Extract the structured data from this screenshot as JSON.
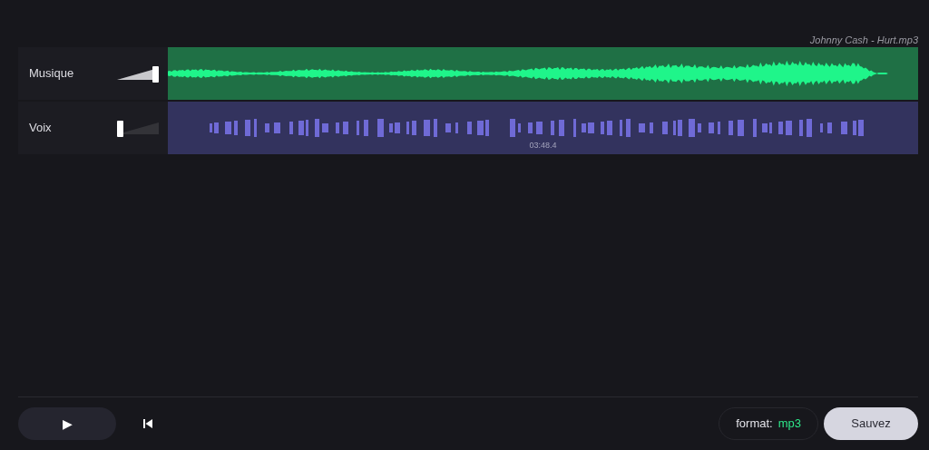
{
  "file_name": "Johnny Cash - Hurt.mp3",
  "tracks": [
    {
      "name": "Musique",
      "kind": "music",
      "muted": false,
      "color": "#1f7045"
    },
    {
      "name": "Voix",
      "kind": "voice",
      "muted": true,
      "color": "#33335e"
    }
  ],
  "position_label": "03:48.4",
  "controls": {
    "play": "▶",
    "format_label": "format:",
    "format_value": "mp3",
    "save": "Sauvez"
  }
}
